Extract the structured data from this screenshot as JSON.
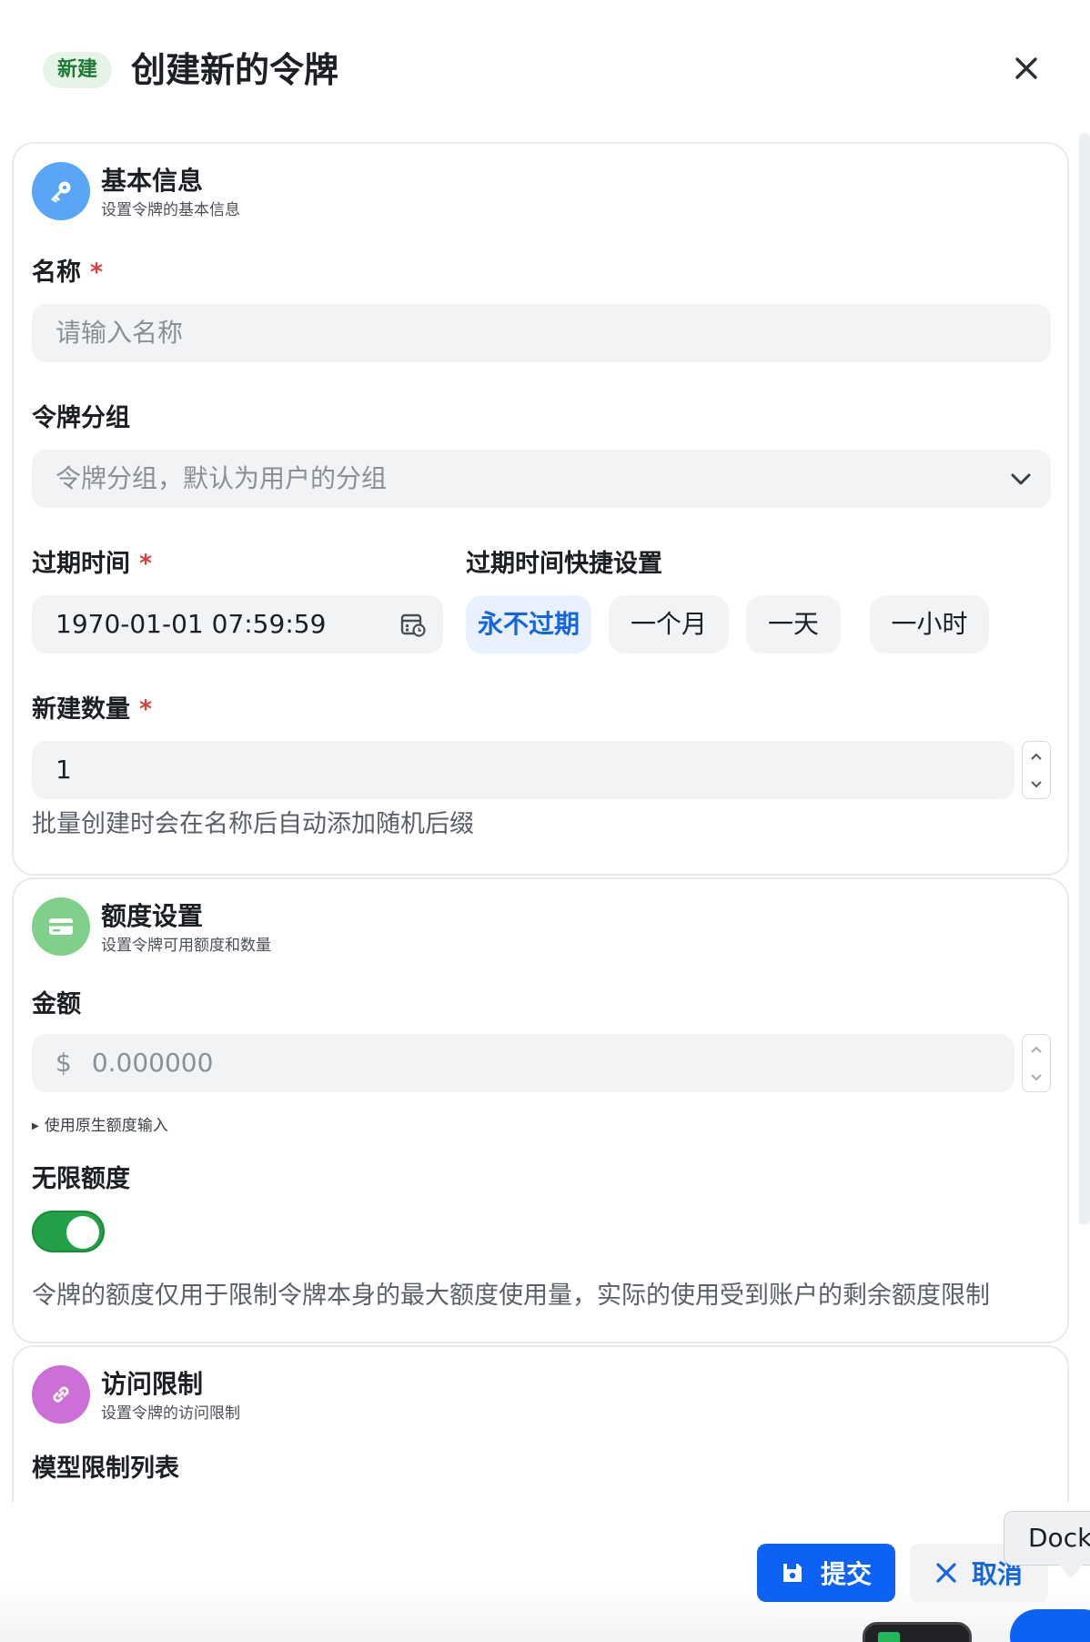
{
  "header": {
    "badge": "新建",
    "title": "创建新的令牌"
  },
  "basic": {
    "title": "基本信息",
    "subtitle": "设置令牌的基本信息",
    "name_label": "名称",
    "name_placeholder": "请输入名称",
    "group_label": "令牌分组",
    "group_placeholder": "令牌分组，默认为用户的分组",
    "expire_label": "过期时间",
    "expire_value": "1970-01-01 07:59:59",
    "quick_label": "过期时间快捷设置",
    "quick_options": [
      "永不过期",
      "一个月",
      "一天",
      "一小时"
    ],
    "count_label": "新建数量",
    "count_value": "1",
    "count_hint": "批量创建时会在名称后自动添加随机后缀"
  },
  "quota": {
    "title": "额度设置",
    "subtitle": "设置令牌可用额度和数量",
    "amount_label": "金额",
    "amount_prefix": "$",
    "amount_placeholder": "0.000000",
    "native_input_hint": "使用原生额度输入",
    "unlimited_label": "无限额度",
    "unlimited_on": true,
    "unlimited_hint": "令牌的额度仅用于限制令牌本身的最大额度使用量，实际的使用受到账户的剩余额度限制"
  },
  "access": {
    "title": "访问限制",
    "subtitle": "设置令牌的访问限制",
    "model_list_label": "模型限制列表"
  },
  "footer": {
    "submit": "提交",
    "cancel": "取消",
    "tooltip": "Docker"
  },
  "colors": {
    "primary": "#0b62f5",
    "success": "#22a148",
    "required": "#e23b3b"
  },
  "required_mark": "*"
}
